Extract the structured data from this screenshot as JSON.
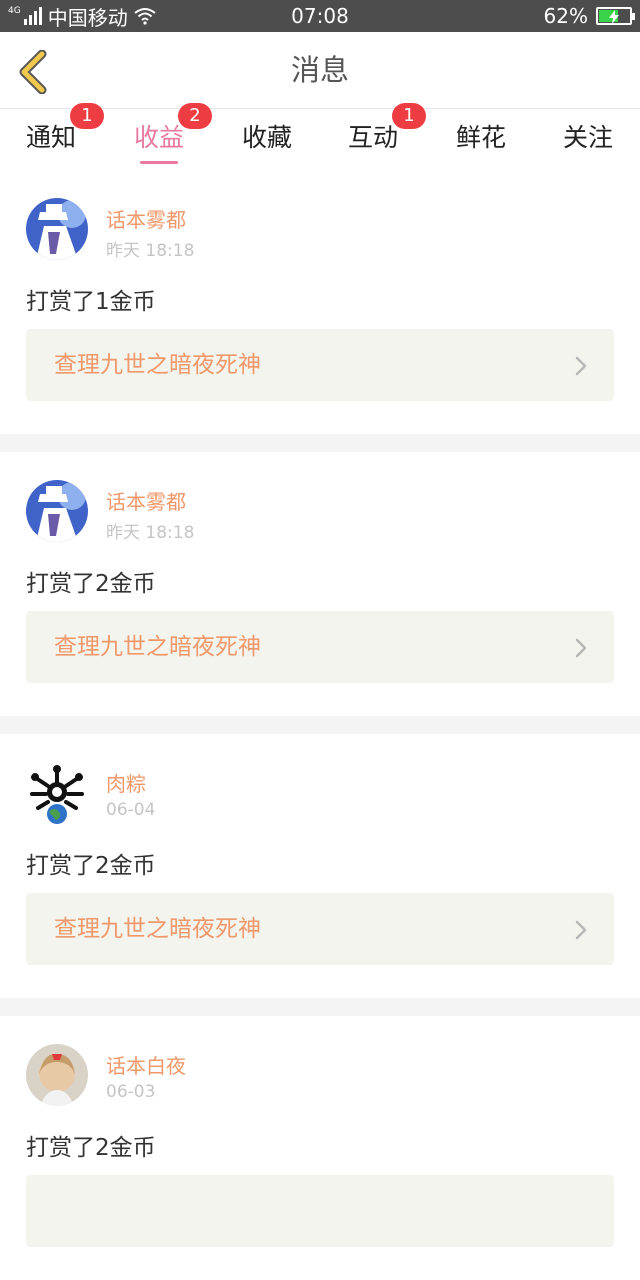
{
  "status_bar": {
    "network": "4G",
    "carrier": "中国移动",
    "time": "07:08",
    "battery": "62%",
    "battery_level": 0.62
  },
  "header": {
    "title": "消息"
  },
  "tabs": [
    {
      "label": "通知",
      "badge": "1",
      "active": false
    },
    {
      "label": "收益",
      "badge": "2",
      "active": true
    },
    {
      "label": "收藏",
      "badge": "",
      "active": false
    },
    {
      "label": "互动",
      "badge": "1",
      "active": false
    },
    {
      "label": "鲜花",
      "badge": "",
      "active": false
    },
    {
      "label": "关注",
      "badge": "",
      "active": false
    }
  ],
  "messages": [
    {
      "user": "话本雾都",
      "time": "昨天 18:18",
      "text": "打赏了1金币",
      "book": "查理九世之暗夜死神"
    },
    {
      "user": "话本雾都",
      "time": "昨天 18:18",
      "text": "打赏了2金币",
      "book": "查理九世之暗夜死神"
    },
    {
      "user": "肉粽",
      "time": "06-04",
      "text": "打赏了2金币",
      "book": "查理九世之暗夜死神"
    },
    {
      "user": "话本白夜",
      "time": "06-03",
      "text": "打赏了2金币",
      "book": ""
    }
  ],
  "colors": {
    "accent_pink": "#e8789f",
    "accent_orange": "#f0986a",
    "badge_red": "#ee3d42",
    "back_arrow": "#f2c94c"
  }
}
